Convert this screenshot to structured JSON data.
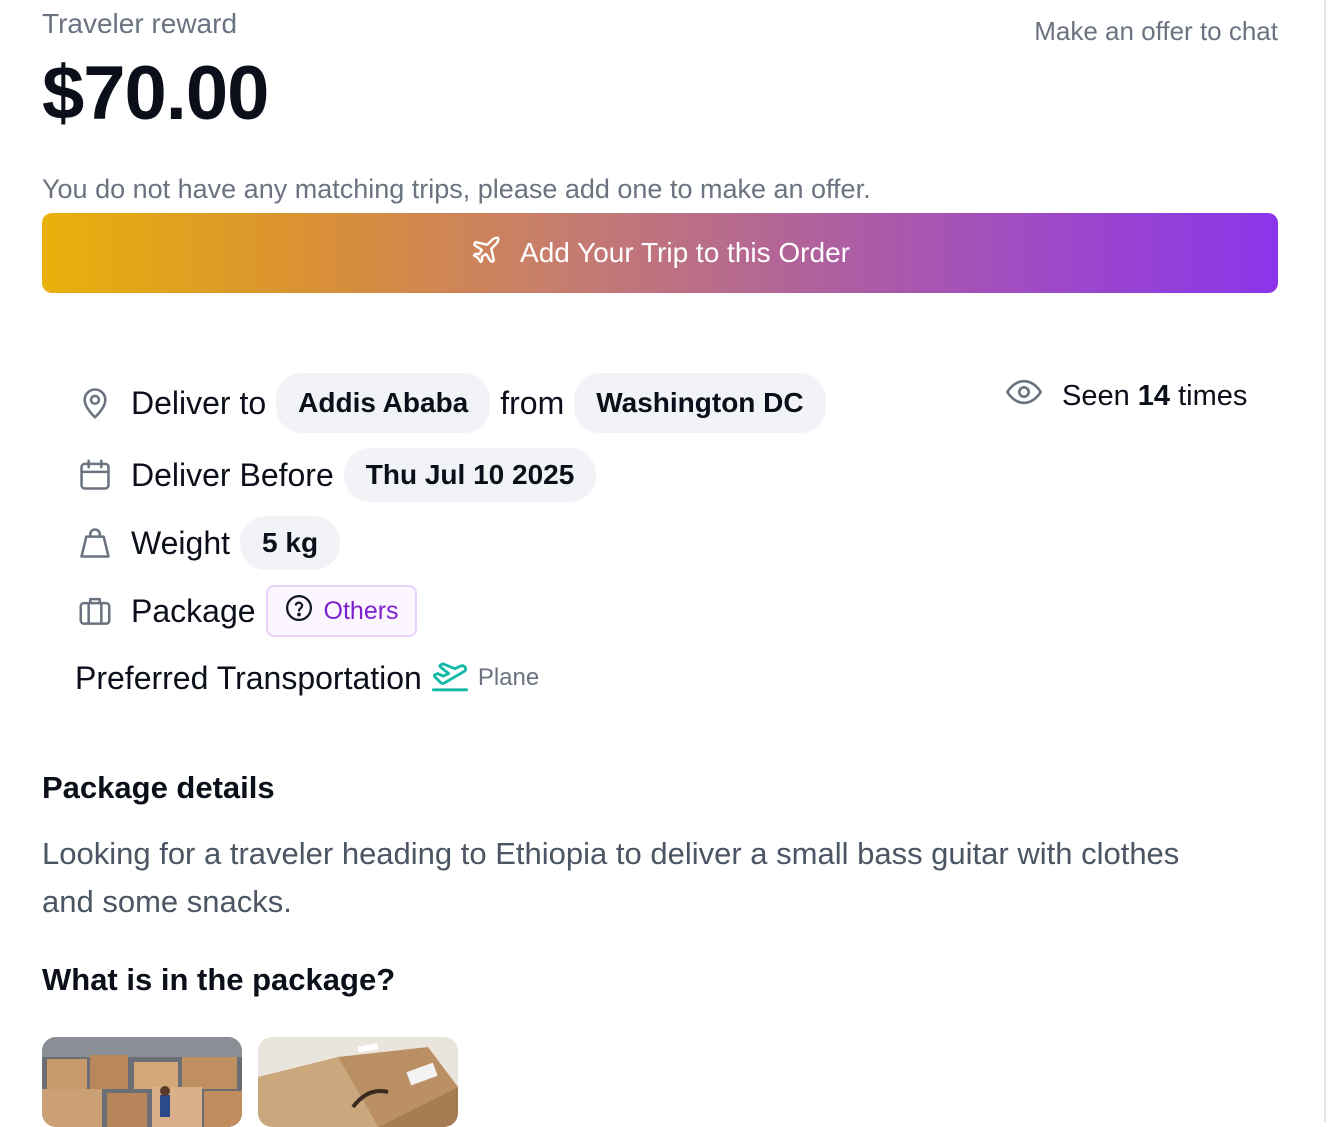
{
  "header": {
    "reward_label": "Traveler reward",
    "reward_amount": "$70.00",
    "offer_chat_link": "Make an offer to chat"
  },
  "notice": "You do not have any matching trips, please add one to make an offer.",
  "add_trip_button": {
    "label": "Add Your Trip to this Order",
    "icon": "plane-icon"
  },
  "delivery": {
    "deliver_to_label": "Deliver to",
    "destination": "Addis Ababa",
    "from_label": "from",
    "origin": "Washington DC",
    "deliver_before_label": "Deliver Before",
    "deliver_before_date": "Thu Jul 10 2025",
    "weight_label": "Weight",
    "weight_value": "5 kg",
    "package_label": "Package",
    "package_type": "Others",
    "transport_label": "Preferred Transportation",
    "transport_mode": "Plane"
  },
  "views": {
    "prefix": "Seen",
    "count": "14",
    "suffix": "times"
  },
  "package_details": {
    "heading": "Package details",
    "text": "Looking for a traveler heading to Ethiopia to deliver a small bass guitar with clothes and some snacks."
  },
  "contents": {
    "heading": "What is in the package?",
    "images": [
      "warehouse-boxes-photo",
      "cardboard-box-photo"
    ]
  },
  "colors": {
    "gradient_start": "#e8b10a",
    "gradient_end": "#8c34ea",
    "others_purple": "#7e22ce",
    "plane_teal": "#14b8a6"
  }
}
